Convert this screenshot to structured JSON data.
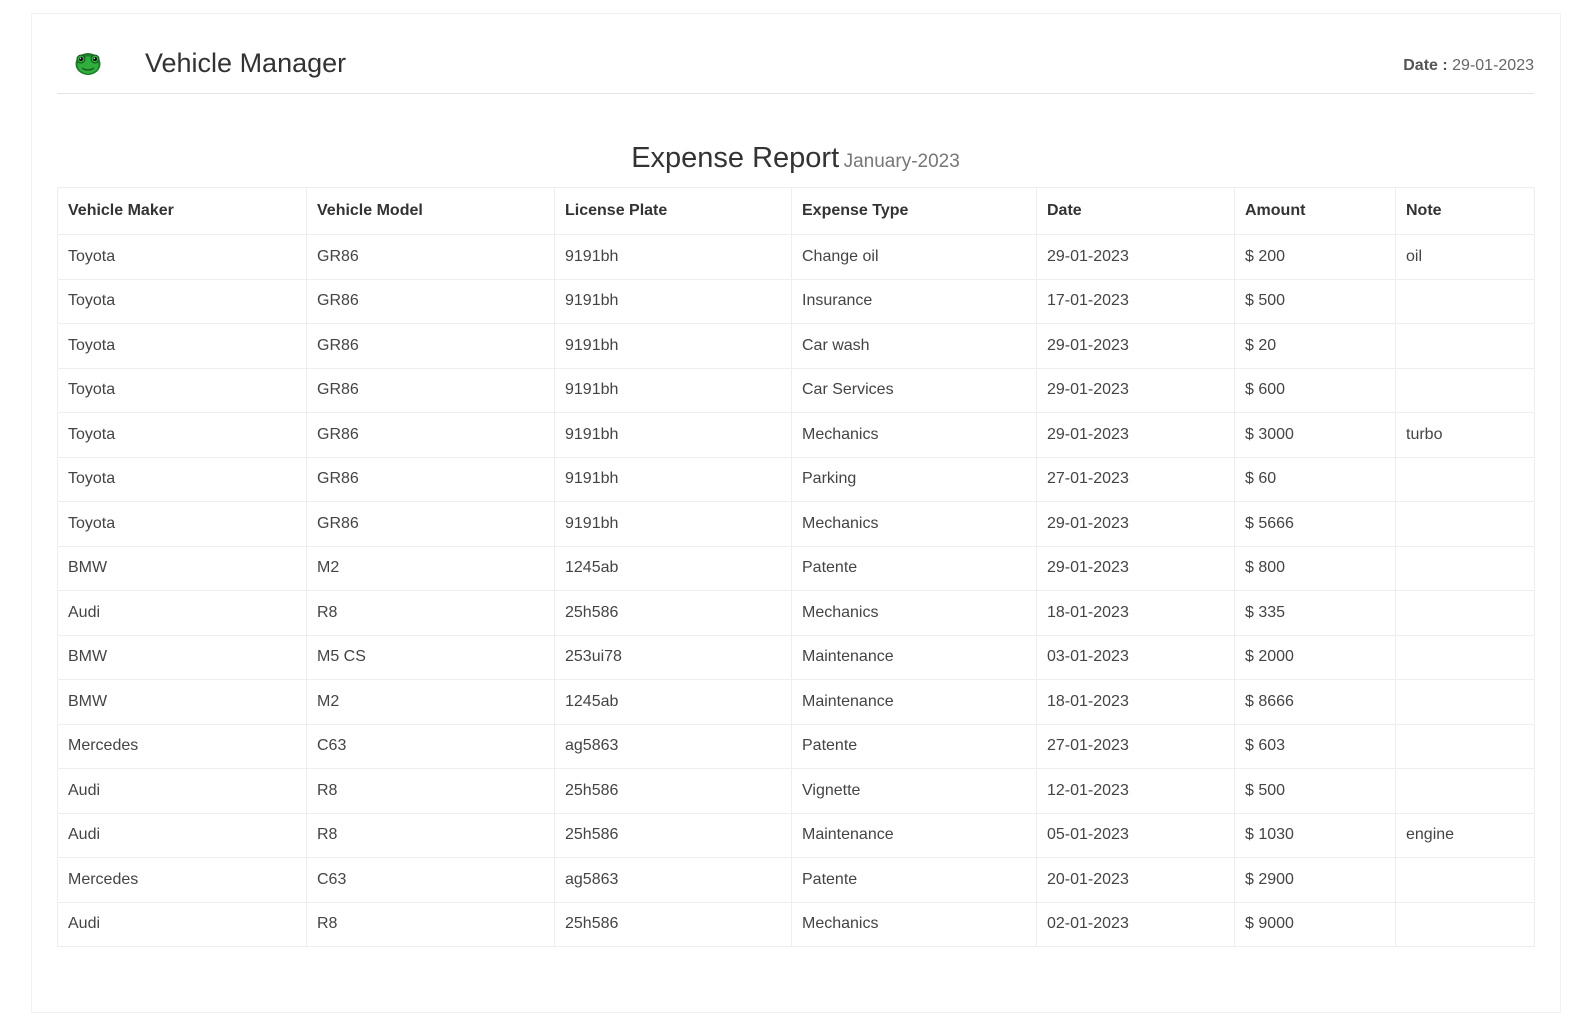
{
  "header": {
    "title": "Vehicle Manager",
    "date_label": "Date :",
    "date_value": "29-01-2023"
  },
  "report": {
    "title": "Expense Report",
    "month": "January-2023"
  },
  "table": {
    "columns": [
      "Vehicle Maker",
      "Vehicle Model",
      "License Plate",
      "Expense Type",
      "Date",
      "Amount",
      "Note"
    ],
    "rows": [
      [
        "Toyota",
        "GR86",
        "9191bh",
        "Change oil",
        "29-01-2023",
        "$ 200",
        "oil"
      ],
      [
        "Toyota",
        "GR86",
        "9191bh",
        "Insurance",
        "17-01-2023",
        "$ 500",
        ""
      ],
      [
        "Toyota",
        "GR86",
        "9191bh",
        "Car wash",
        "29-01-2023",
        "$ 20",
        ""
      ],
      [
        "Toyota",
        "GR86",
        "9191bh",
        "Car Services",
        "29-01-2023",
        "$ 600",
        ""
      ],
      [
        "Toyota",
        "GR86",
        "9191bh",
        "Mechanics",
        "29-01-2023",
        "$ 3000",
        "turbo"
      ],
      [
        "Toyota",
        "GR86",
        "9191bh",
        "Parking",
        "27-01-2023",
        "$ 60",
        ""
      ],
      [
        "Toyota",
        "GR86",
        "9191bh",
        "Mechanics",
        "29-01-2023",
        "$ 5666",
        ""
      ],
      [
        "BMW",
        "M2",
        "1245ab",
        "Patente",
        "29-01-2023",
        "$ 800",
        ""
      ],
      [
        "Audi",
        "R8",
        "25h586",
        "Mechanics",
        "18-01-2023",
        "$ 335",
        ""
      ],
      [
        "BMW",
        "M5 CS",
        "253ui78",
        "Maintenance",
        "03-01-2023",
        "$ 2000",
        ""
      ],
      [
        "BMW",
        "M2",
        "1245ab",
        "Maintenance",
        "18-01-2023",
        "$ 8666",
        ""
      ],
      [
        "Mercedes",
        "C63",
        "ag5863",
        "Patente",
        "27-01-2023",
        "$ 603",
        ""
      ],
      [
        "Audi",
        "R8",
        "25h586",
        "Vignette",
        "12-01-2023",
        "$ 500",
        ""
      ],
      [
        "Audi",
        "R8",
        "25h586",
        "Maintenance",
        "05-01-2023",
        "$ 1030",
        "engine"
      ],
      [
        "Mercedes",
        "C63",
        "ag5863",
        "Patente",
        "20-01-2023",
        "$ 2900",
        ""
      ],
      [
        "Audi",
        "R8",
        "25h586",
        "Mechanics",
        "02-01-2023",
        "$ 9000",
        ""
      ]
    ]
  },
  "colors": {
    "logo_green": "#2fae3c",
    "border": "#eeeeee",
    "text": "#333333"
  },
  "icons": {
    "logo": "frog-logo-icon"
  }
}
